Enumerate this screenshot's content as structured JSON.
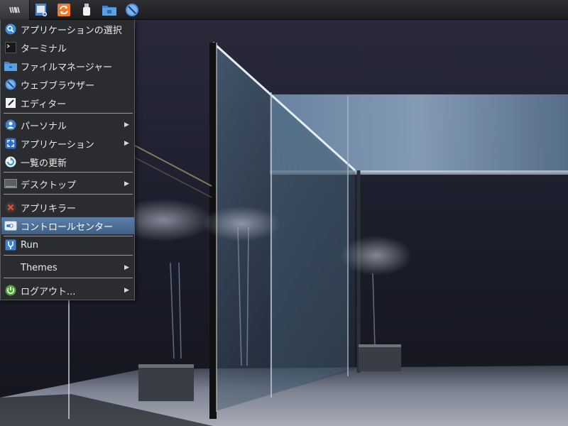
{
  "taskbar": {
    "launchers": [
      {
        "icon": "menu-logo-icon"
      },
      {
        "icon": "notepad-icon"
      },
      {
        "icon": "update-icon"
      },
      {
        "icon": "usb-drive-icon"
      },
      {
        "icon": "folder-icon"
      },
      {
        "icon": "browser-icon"
      }
    ]
  },
  "start_menu": {
    "items": [
      {
        "label": "アプリケーションの選択",
        "icon": "search-icon"
      },
      {
        "label": "ターミナル",
        "icon": "terminal-icon"
      },
      {
        "label": "ファイルマネージャー",
        "icon": "folder-icon"
      },
      {
        "label": "ウェブブラウザー",
        "icon": "browser-icon"
      },
      {
        "label": "エディター",
        "icon": "editor-icon"
      },
      {
        "label": "パーソナル",
        "icon": "user-icon",
        "submenu": true
      },
      {
        "label": "アプリケーション",
        "icon": "apps-icon",
        "submenu": true
      },
      {
        "label": "一覧の更新",
        "icon": "refresh-icon"
      },
      {
        "label": "デスクトップ",
        "icon": "desktop-icon",
        "submenu": true
      },
      {
        "label": "アプリキラー",
        "icon": "kill-icon"
      },
      {
        "label": "コントロールセンター",
        "icon": "control-center-icon",
        "highlighted": true
      },
      {
        "label": "Run",
        "icon": "run-icon"
      },
      {
        "label": "Themes",
        "icon": "",
        "submenu": true
      },
      {
        "label": "ログアウト...",
        "icon": "power-icon",
        "submenu": true
      }
    ]
  },
  "colors": {
    "panel": "#1c1d20",
    "menu_bg": "#2b2c2f",
    "highlight": "#4d6f97",
    "accent_blue": "#3d8ee0"
  }
}
